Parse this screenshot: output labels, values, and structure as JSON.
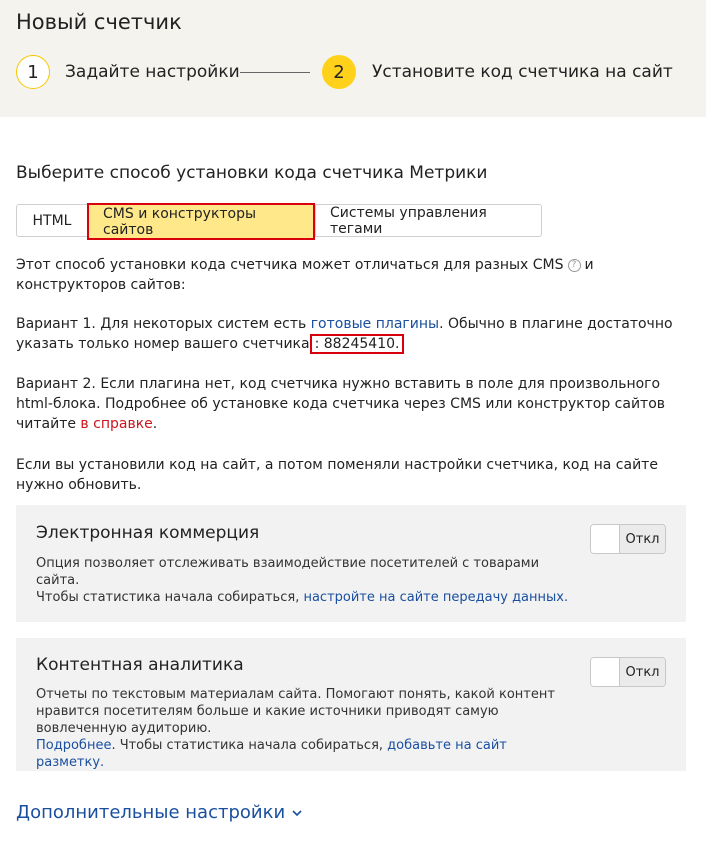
{
  "header": {
    "title": "Новый счетчик",
    "steps": [
      {
        "number": "1",
        "label": "Задайте настройки"
      },
      {
        "number": "2",
        "label": "Установите код счетчика на сайт"
      }
    ]
  },
  "install": {
    "title": "Выберите способ установки кода счетчика Метрики",
    "tabs": [
      {
        "label": "HTML"
      },
      {
        "label": "CMS и конструкторы сайтов",
        "selected": true
      },
      {
        "label": "Системы управления тегами"
      }
    ],
    "intro_part1": "Этот способ установки кода счетчика может отличаться для разных CMS",
    "intro_part2": "и конструкторов сайтов:",
    "variant1_prefix": "Вариант 1. Для некоторых систем есть ",
    "variant1_link": "готовые плагины",
    "variant1_mid": ". Обычно в плагине достаточно указать только номер вашего счетчика",
    "counter_number": ": 88245410.",
    "variant2_text": "Вариант 2. Если плагина нет, код счетчика нужно вставить в поле для произвольного html-блока. Подробнее об установке кода счетчика через CMS или конструктор сайтов читайте ",
    "variant2_link": "в справке",
    "variant2_end": ".",
    "update_note": "Если вы установили код на сайт, а потом поменяли настройки счетчика, код на сайте нужно обновить."
  },
  "ecommerce": {
    "title": "Электронная коммерция",
    "desc1": "Опция позволяет отслеживать взаимодействие посетителей с товарами сайта.",
    "desc2": "Чтобы статистика начала собираться, ",
    "desc_link": "настройте на сайте передачу данных.",
    "toggle_label": "Откл"
  },
  "content_analytics": {
    "title": "Контентная аналитика",
    "desc1": "Отчеты по текстовым материалам сайта. Помогают понять, какой контент нравится посетителям больше и какие источники приводят самую вовлеченную аудиторию.",
    "link1": "Подробнее",
    "desc2": ". Чтобы статистика начала собираться, ",
    "link2": "добавьте на сайт разметку.",
    "toggle_label": "Откл"
  },
  "footer": {
    "more_settings": "Дополнительные настройки",
    "icon": "chevron-down-icon"
  },
  "colors": {
    "accent_yellow": "#ffd11a",
    "highlight_red": "#d8000b",
    "link_blue": "#1a4fa0"
  }
}
